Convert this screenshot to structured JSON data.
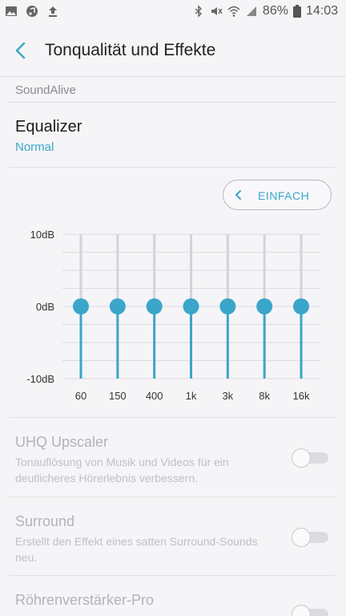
{
  "status_bar": {
    "battery": "86%",
    "time": "14:03",
    "left_icons": [
      "gallery-icon",
      "music-icon",
      "upload-icon"
    ],
    "right_icons": [
      "bluetooth-icon",
      "mute-icon",
      "wifi-icon",
      "signal-icon",
      "battery-icon"
    ]
  },
  "header": {
    "title": "Tonqualität und Effekte",
    "back_icon": "back-arrow-icon"
  },
  "section": {
    "label": "SoundAlive"
  },
  "equalizer": {
    "title": "Equalizer",
    "preset": "Normal",
    "mode_button": "EINFACH",
    "db_labels": [
      "10dB",
      "0dB",
      "-10dB"
    ],
    "range_db": [
      -10,
      10
    ],
    "bands": [
      {
        "label": "60",
        "value_db": 0
      },
      {
        "label": "150",
        "value_db": 0
      },
      {
        "label": "400",
        "value_db": 0
      },
      {
        "label": "1k",
        "value_db": 0
      },
      {
        "label": "3k",
        "value_db": 0
      },
      {
        "label": "8k",
        "value_db": 0
      },
      {
        "label": "16k",
        "value_db": 0
      }
    ]
  },
  "settings": [
    {
      "title": "UHQ Upscaler",
      "description": "Tonauflösung von Musik und Videos für ein deutlicheres Hörerlebnis verbessern.",
      "enabled": false
    },
    {
      "title": "Surround",
      "description": "Erstellt den Effekt eines satten Surround-Sounds neu.",
      "enabled": false
    },
    {
      "title": "Röhrenverstärker-Pro",
      "description": "",
      "enabled": false
    }
  ],
  "colors": {
    "accent": "#3aa6c9",
    "disabled_text": "#b3b3b8",
    "background": "#f5f5f7"
  }
}
